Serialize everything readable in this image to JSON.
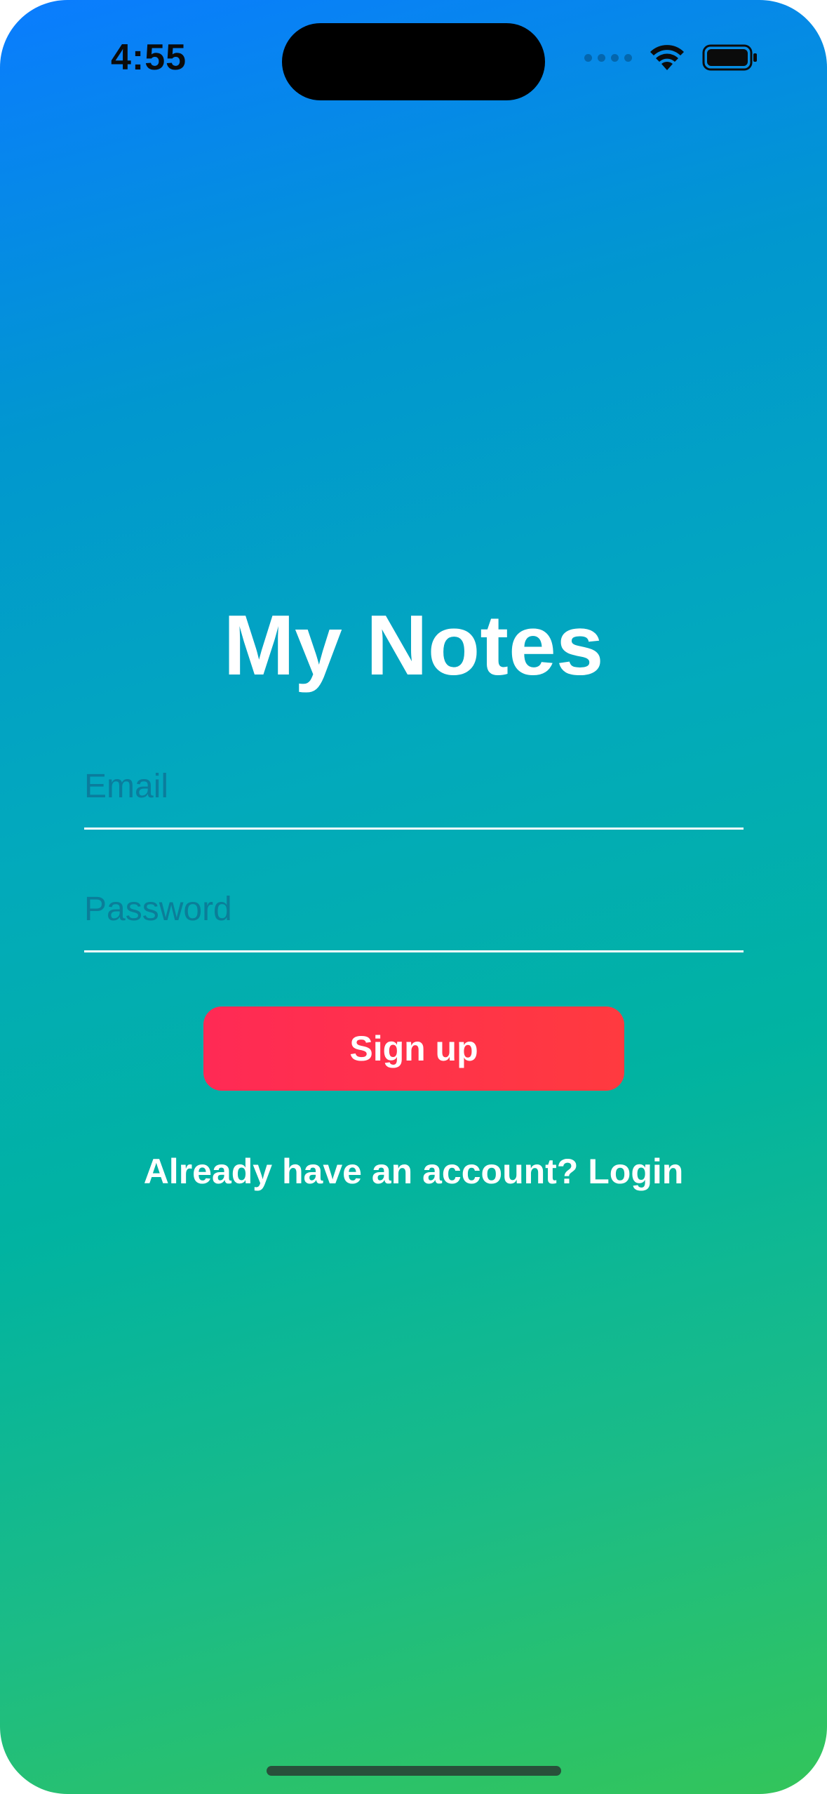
{
  "status_bar": {
    "time": "4:55",
    "wifi_icon": "wifi-icon",
    "battery_icon": "battery-full-icon",
    "signal_icon": "cellular-signal-dots-icon"
  },
  "app": {
    "title": "My Notes"
  },
  "form": {
    "email_placeholder": "Email",
    "email_value": "",
    "password_placeholder": "Password",
    "password_value": "",
    "signup_label": "Sign up",
    "login_prompt": "Already have an account? Login"
  },
  "colors": {
    "gradient_top": "#0a7cff",
    "gradient_bottom": "#33c55a",
    "button": "#ff2d55"
  }
}
